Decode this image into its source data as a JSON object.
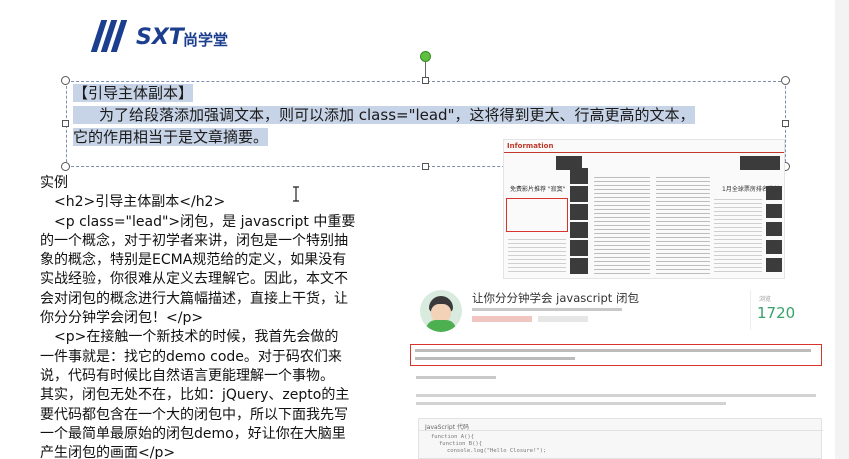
{
  "logo": {
    "text": "SXT",
    "cn": "尚学堂"
  },
  "textbox": {
    "title": "【引导主体副本】",
    "line1": "为了给段落添加强调文本，则可以添加 class=\"lead\"，这将得到更大、行高更高的文本，",
    "line2": "它的作用相当于是文章摘要。"
  },
  "example": {
    "lines": [
      "实例",
      "　<h2>引导主体副本</h2>",
      "　<p class=\"lead\">闭包，是 javascript 中重要",
      "的一个概念，对于初学者来讲，闭包是一个特别抽",
      "象的概念，特别是ECMA规范给的定义，如果没有",
      "实战经验，你很难从定义去理解它。因此，本文不",
      "会对闭包的概念进行大篇幅描述，直接上干货，让",
      "你分分钟学会闭包！</p>",
      "　<p>在接触一个新技术的时候，我首先会做的",
      "一件事就是：找它的demo code。对于码农们来",
      "说，代码有时候比自然语言更能理解一个事物。",
      "其实，闭包无处不在，比如：jQuery、zepto的主",
      "要代码都包含在一个大的闭包中，所以下面我先写",
      "一个最简单最原始的闭包demo，好让你在大脑里",
      "产生闭包的画面</p>"
    ]
  },
  "shot1": {
    "brand": "Information",
    "heading1": "免费影片推荐 \"寂寞\"",
    "heading2": "1月全球票房排名推荐"
  },
  "shot2": {
    "title": "让你分分钟学会 javascript 闭包",
    "views_label": "浏览",
    "views": "1720",
    "tab": "JavaScript 代码",
    "code1": "function A(){",
    "code2": "function B(){",
    "code3": "console.log(\"Hello Closure!\");"
  },
  "colors": {
    "brand": "#1b3e8e",
    "highlight": "#c7d3e6",
    "green": "#5fbf3f",
    "red_box": "#d9342b"
  }
}
